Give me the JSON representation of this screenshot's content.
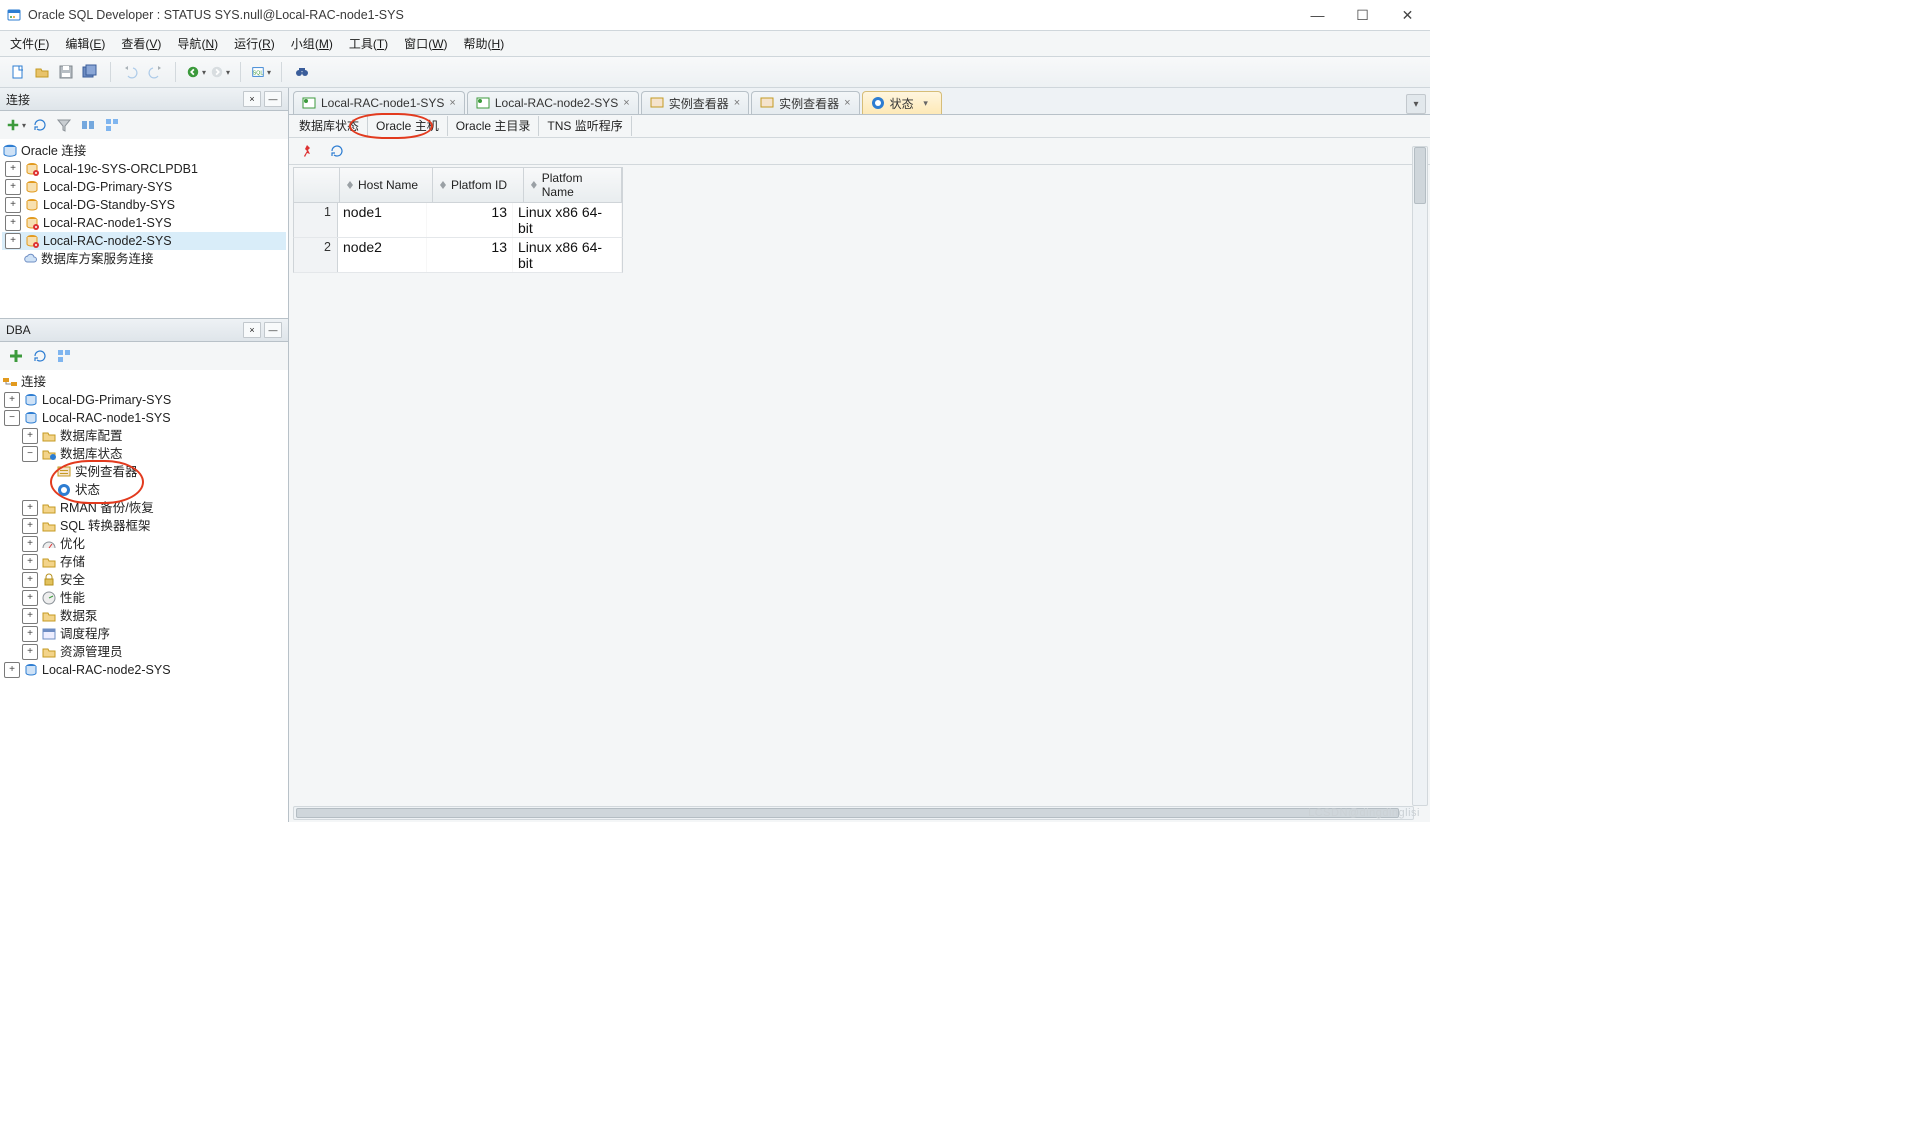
{
  "window": {
    "title": "Oracle SQL Developer : STATUS SYS.null@Local-RAC-node1-SYS"
  },
  "menu": [
    {
      "label": "文件",
      "accel": "F"
    },
    {
      "label": "编辑",
      "accel": "E"
    },
    {
      "label": "查看",
      "accel": "V"
    },
    {
      "label": "导航",
      "accel": "N"
    },
    {
      "label": "运行",
      "accel": "R"
    },
    {
      "label": "小组",
      "accel": "M"
    },
    {
      "label": "工具",
      "accel": "T"
    },
    {
      "label": "窗口",
      "accel": "W"
    },
    {
      "label": "帮助",
      "accel": "H"
    }
  ],
  "connections_panel": {
    "title": "连接",
    "root": "Oracle 连接",
    "items": [
      "Local-19c-SYS-ORCLPDB1",
      "Local-DG-Primary-SYS",
      "Local-DG-Standby-SYS",
      "Local-RAC-node1-SYS",
      "Local-RAC-node2-SYS"
    ],
    "cloud": "数据库方案服务连接"
  },
  "dba_panel": {
    "title": "DBA",
    "root": "连接",
    "tree": {
      "n0": "Local-DG-Primary-SYS",
      "n1": "Local-RAC-node1-SYS",
      "n1_children": {
        "c0": "数据库配置",
        "c1": "数据库状态",
        "c1_children": {
          "s0": "实例查看器",
          "s1": "状态"
        },
        "c2": "RMAN 备份/恢复",
        "c3": "SQL 转换器框架",
        "c4": "优化",
        "c5": "存储",
        "c6": "安全",
        "c7": "性能",
        "c8": "数据泵",
        "c9": "调度程序",
        "c10": "资源管理员"
      },
      "n2": "Local-RAC-node2-SYS"
    }
  },
  "tabs": [
    "Local-RAC-node1-SYS",
    "Local-RAC-node2-SYS",
    "实例查看器",
    "实例查看器",
    "状态"
  ],
  "sub_tabs": [
    "数据库状态",
    "Oracle 主机",
    "Oracle 主目录",
    "TNS 监听程序"
  ],
  "table": {
    "headers": [
      "Host Name",
      "Platfom ID",
      "Platfom Name"
    ],
    "rows": [
      {
        "idx": "1",
        "host": "node1",
        "pid": "13",
        "pname": "Linux x86 64-bit"
      },
      {
        "idx": "2",
        "host": "node2",
        "pid": "13",
        "pname": "Linux x86 64-bit"
      }
    ]
  },
  "watermark": "LCSDN@dingdinglisi"
}
